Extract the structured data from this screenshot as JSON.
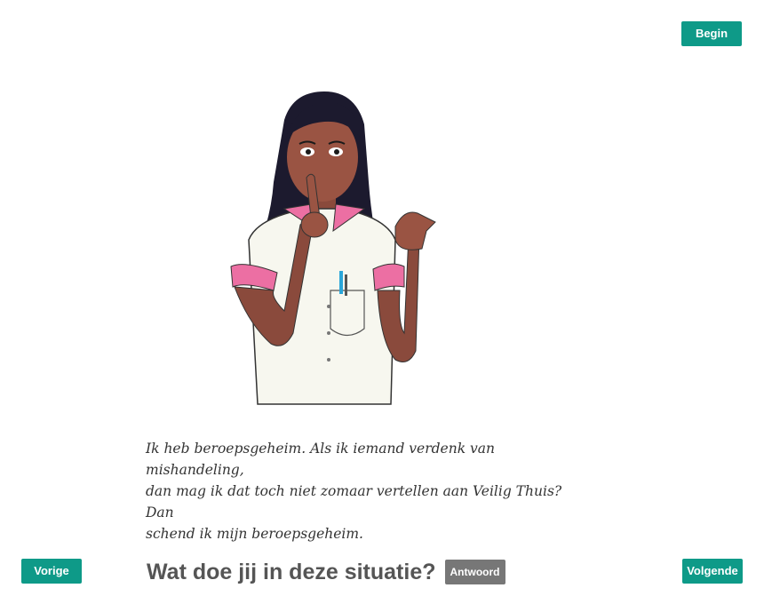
{
  "nav": {
    "begin_label": "Begin",
    "prev_label": "Vorige",
    "next_label": "Volgende"
  },
  "scene": {
    "quote_lines": [
      "Ik heb beroepsgeheim. Als ik iemand verdenk van mishandeling,",
      "dan mag ik dat toch niet zomaar vertellen aan Veilig Thuis? Dan",
      "schend ik mijn beroepsgeheim."
    ]
  },
  "prompt": {
    "question": "Wat doe jij in deze situatie?",
    "answer_label": "Antwoord"
  },
  "colors": {
    "accent": "#0e9a88",
    "answer_button": "#777777",
    "uniform_trim": "#ec6fa3"
  }
}
